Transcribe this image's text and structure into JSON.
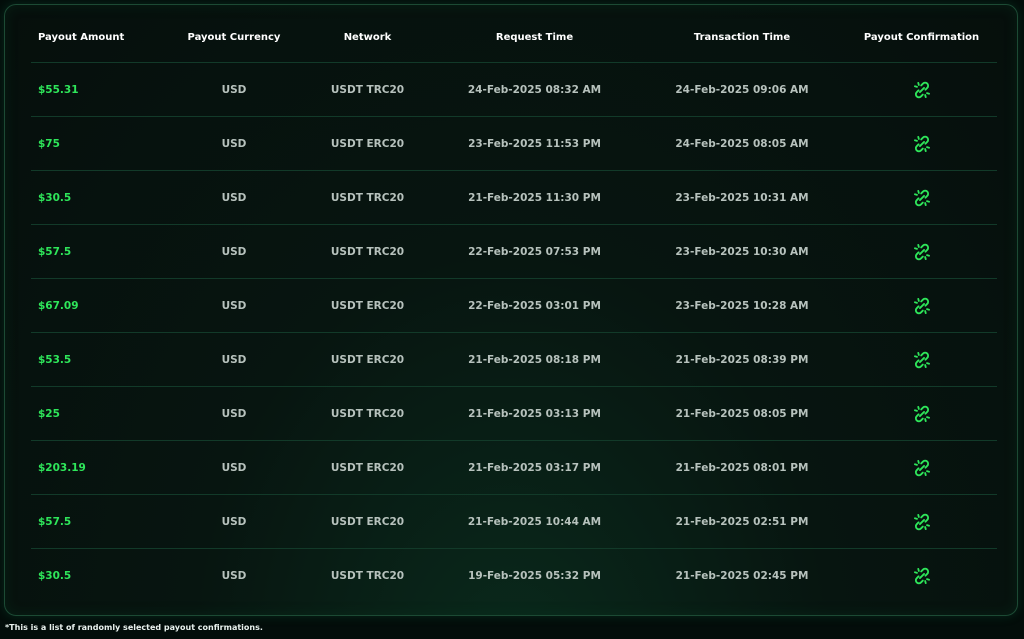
{
  "colors": {
    "accent": "#2ee65a",
    "background": "#030d0a",
    "text": "#b7c2bd",
    "border": "#123a29"
  },
  "table": {
    "headers": {
      "amount": "Payout Amount",
      "currency": "Payout Currency",
      "network": "Network",
      "request_time": "Request Time",
      "transaction_time": "Transaction Time",
      "confirmation": "Payout Confirmation"
    },
    "confirmation_icon": "chain-link-icon",
    "rows": [
      {
        "amount": "$55.31",
        "currency": "USD",
        "network": "USDT TRC20",
        "request_time": "24-Feb-2025 08:32 AM",
        "transaction_time": "24-Feb-2025 09:06 AM"
      },
      {
        "amount": "$75",
        "currency": "USD",
        "network": "USDT ERC20",
        "request_time": "23-Feb-2025 11:53 PM",
        "transaction_time": "24-Feb-2025 08:05 AM"
      },
      {
        "amount": "$30.5",
        "currency": "USD",
        "network": "USDT TRC20",
        "request_time": "21-Feb-2025 11:30 PM",
        "transaction_time": "23-Feb-2025 10:31 AM"
      },
      {
        "amount": "$57.5",
        "currency": "USD",
        "network": "USDT TRC20",
        "request_time": "22-Feb-2025 07:53 PM",
        "transaction_time": "23-Feb-2025 10:30 AM"
      },
      {
        "amount": "$67.09",
        "currency": "USD",
        "network": "USDT ERC20",
        "request_time": "22-Feb-2025 03:01 PM",
        "transaction_time": "23-Feb-2025 10:28 AM"
      },
      {
        "amount": "$53.5",
        "currency": "USD",
        "network": "USDT ERC20",
        "request_time": "21-Feb-2025 08:18 PM",
        "transaction_time": "21-Feb-2025 08:39 PM"
      },
      {
        "amount": "$25",
        "currency": "USD",
        "network": "USDT TRC20",
        "request_time": "21-Feb-2025 03:13 PM",
        "transaction_time": "21-Feb-2025 08:05 PM"
      },
      {
        "amount": "$203.19",
        "currency": "USD",
        "network": "USDT ERC20",
        "request_time": "21-Feb-2025 03:17 PM",
        "transaction_time": "21-Feb-2025 08:01 PM"
      },
      {
        "amount": "$57.5",
        "currency": "USD",
        "network": "USDT ERC20",
        "request_time": "21-Feb-2025 10:44 AM",
        "transaction_time": "21-Feb-2025 02:51 PM"
      },
      {
        "amount": "$30.5",
        "currency": "USD",
        "network": "USDT TRC20",
        "request_time": "19-Feb-2025 05:32 PM",
        "transaction_time": "21-Feb-2025 02:45 PM"
      }
    ]
  },
  "footnote": "*This is a list of randomly selected payout confirmations."
}
